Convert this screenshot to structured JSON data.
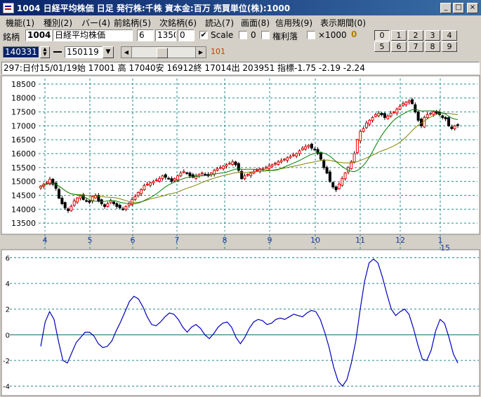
{
  "window": {
    "title": "1004 日経平均株価  日足    発行株:千株  資本金:百万  売買単位(株):1000",
    "min_label": "_",
    "max_label": "□",
    "close_label": "×"
  },
  "menu": [
    "機能(1)",
    "種別(2)",
    "バー(4)",
    "前銘柄(5)",
    "次銘柄(6)",
    "読込(7)",
    "画面(8)",
    "信用残(9)",
    "表示期間(0)"
  ],
  "toolbar": {
    "code_label": "銘柄",
    "code": "1004",
    "name": "日経平均株価",
    "field1": "6",
    "field2": "1350",
    "field3": "0",
    "scale_checked": "✔",
    "scale_label": "Scale",
    "zero_label": "0",
    "kenri_label": "権利落",
    "x1000_label": "×1000",
    "badge": "0",
    "num_buttons": [
      "0",
      "1",
      "2",
      "3",
      "4",
      "5",
      "6",
      "7",
      "8",
      "9"
    ],
    "date_from": "140331",
    "date_to": "150119",
    "scroll_value": "101"
  },
  "info": "297:日付15/01/19始 17001 高 17040安 16912終 17014出 203951 指標-1.75  -2.19  -2.24",
  "colors": {
    "up": "#ff0000",
    "down": "#000000",
    "ma_short": "#008000",
    "ma_long": "#808000",
    "osc": "#0000c0",
    "grid": "#2a8a8a"
  },
  "chart_data": [
    {
      "type": "candlestick",
      "ylim": [
        13200,
        18700
      ],
      "yticks": [
        13500,
        14000,
        14500,
        15000,
        15500,
        16000,
        16500,
        17000,
        17500,
        18000,
        18500
      ],
      "xticks": [
        "4",
        "5",
        "6",
        "7",
        "8",
        "9",
        "10",
        "11",
        "12",
        "1"
      ],
      "year_label": "15",
      "closes": [
        14827,
        14900,
        14950,
        15080,
        14900,
        14750,
        14400,
        14200,
        14050,
        13950,
        14100,
        14300,
        14400,
        14480,
        14350,
        14300,
        14250,
        14450,
        14500,
        14300,
        14200,
        14100,
        14200,
        14300,
        14200,
        14100,
        14050,
        14000,
        14100,
        14200,
        14350,
        14450,
        14600,
        14700,
        14850,
        14900,
        14950,
        15000,
        15050,
        15100,
        15200,
        15150,
        15100,
        15000,
        15100,
        15200,
        15300,
        15350,
        15300,
        15200,
        15150,
        15200,
        15250,
        15300,
        15250,
        15200,
        15300,
        15400,
        15450,
        15500,
        15550,
        15600,
        15650,
        15700,
        15600,
        15400,
        15100,
        15200,
        15250,
        15300,
        15350,
        15400,
        15450,
        15450,
        15500,
        15550,
        15600,
        15650,
        15700,
        15750,
        15800,
        15850,
        15900,
        15950,
        16000,
        16100,
        16200,
        16250,
        16300,
        16200,
        16150,
        16000,
        15800,
        15500,
        15300,
        15000,
        14800,
        14700,
        14900,
        15100,
        15300,
        15500,
        15700,
        16000,
        16500,
        16800,
        16900,
        17100,
        17200,
        17300,
        17400,
        17450,
        17400,
        17300,
        17350,
        17450,
        17500,
        17600,
        17700,
        17800,
        17850,
        17900,
        17800,
        17500,
        17200,
        17000,
        17300,
        17400,
        17450,
        17500,
        17450,
        17400,
        17300,
        17250,
        17000,
        16900,
        17000,
        17014
      ]
    },
    {
      "type": "line",
      "ylim": [
        -4.3,
        6.3
      ],
      "yticks": [
        -4,
        -2,
        0,
        2,
        4,
        6
      ],
      "values": [
        -0.9,
        1.0,
        1.8,
        1.2,
        -0.5,
        -2.0,
        -2.2,
        -1.4,
        -0.6,
        -0.2,
        0.2,
        0.2,
        -0.1,
        -0.7,
        -1.0,
        -0.9,
        -0.5,
        0.3,
        1.0,
        1.8,
        2.6,
        3.0,
        2.8,
        2.2,
        1.4,
        0.8,
        0.7,
        1.0,
        1.4,
        1.7,
        1.6,
        1.2,
        0.6,
        0.2,
        0.6,
        0.8,
        0.5,
        0.0,
        -0.3,
        0.1,
        0.6,
        0.9,
        1.0,
        0.6,
        -0.2,
        -0.7,
        -0.2,
        0.5,
        1.0,
        1.2,
        1.1,
        0.8,
        0.9,
        1.2,
        1.3,
        1.2,
        1.4,
        1.6,
        1.5,
        1.4,
        1.7,
        1.9,
        1.8,
        1.2,
        0.2,
        -1.0,
        -2.5,
        -3.6,
        -4.0,
        -3.5,
        -2.2,
        -0.5,
        2.0,
        4.2,
        5.6,
        5.9,
        5.6,
        4.5,
        3.2,
        2.0,
        1.5,
        1.8,
        2.0,
        1.6,
        0.5,
        -0.8,
        -1.9,
        -2.0,
        -1.2,
        0.3,
        1.2,
        0.9,
        -0.2,
        -1.5,
        -2.2
      ]
    }
  ]
}
